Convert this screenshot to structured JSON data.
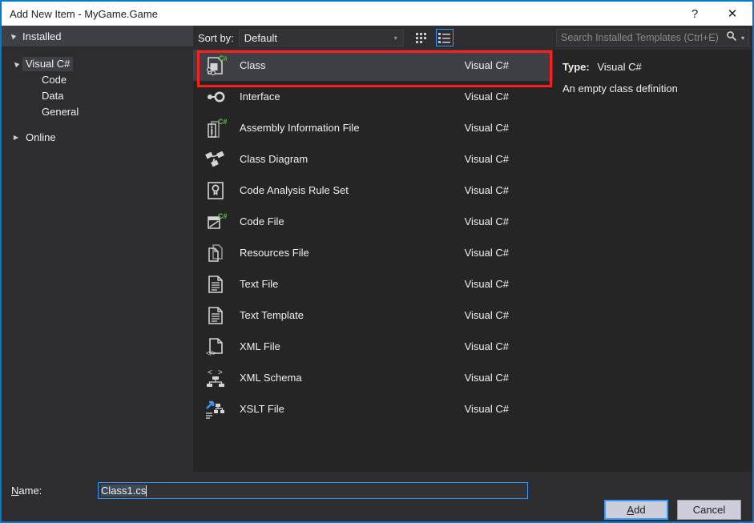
{
  "window": {
    "title": "Add New Item - MyGame.Game",
    "help_label": "?",
    "close_label": "✕"
  },
  "tree": {
    "header": "Installed",
    "root": "Visual C#",
    "children": [
      "Code",
      "Data",
      "General"
    ],
    "online": "Online"
  },
  "sort": {
    "label": "Sort by:",
    "value": "Default",
    "caret": "▾",
    "grid_view_icon": "grid-view-icon",
    "list_view_icon": "list-view-icon"
  },
  "search": {
    "placeholder": "Search Installed Templates (Ctrl+E)",
    "icon": "search-icon",
    "caret": "▾"
  },
  "templates": [
    {
      "name": "Class",
      "lang": "Visual C#",
      "icon": "class-csharp-icon",
      "selected": true
    },
    {
      "name": "Interface",
      "lang": "Visual C#",
      "icon": "interface-icon",
      "selected": false
    },
    {
      "name": "Assembly Information File",
      "lang": "Visual C#",
      "icon": "assembly-info-csharp-icon",
      "selected": false
    },
    {
      "name": "Class Diagram",
      "lang": "Visual C#",
      "icon": "class-diagram-icon",
      "selected": false
    },
    {
      "name": "Code Analysis Rule Set",
      "lang": "Visual C#",
      "icon": "rule-set-icon",
      "selected": false
    },
    {
      "name": "Code File",
      "lang": "Visual C#",
      "icon": "code-file-csharp-icon",
      "selected": false
    },
    {
      "name": "Resources File",
      "lang": "Visual C#",
      "icon": "resources-file-icon",
      "selected": false
    },
    {
      "name": "Text File",
      "lang": "Visual C#",
      "icon": "text-file-icon",
      "selected": false
    },
    {
      "name": "Text Template",
      "lang": "Visual C#",
      "icon": "text-template-icon",
      "selected": false
    },
    {
      "name": "XML File",
      "lang": "Visual C#",
      "icon": "xml-file-icon",
      "selected": false
    },
    {
      "name": "XML Schema",
      "lang": "Visual C#",
      "icon": "xml-schema-icon",
      "selected": false
    },
    {
      "name": "XSLT File",
      "lang": "Visual C#",
      "icon": "xslt-file-icon",
      "selected": false
    }
  ],
  "details": {
    "type_key": "Type:",
    "type_value": "Visual C#",
    "description": "An empty class definition"
  },
  "name_field": {
    "label_accel": "N",
    "label_rest": "ame:",
    "value": "Class1.cs"
  },
  "buttons": {
    "add_accel": "A",
    "add_rest": "dd",
    "cancel": "Cancel"
  },
  "annotation": {
    "shape": "red-rectangle-highlight",
    "target": "Class"
  },
  "colors": {
    "accent": "#007acc",
    "focus_border": "#3399ff",
    "annotation": "#ff1e1e",
    "csharp_badge": "#6cc24a",
    "panel_bg": "#2d2d30",
    "list_bg": "#252526",
    "selected_row": "#3f3f46"
  }
}
